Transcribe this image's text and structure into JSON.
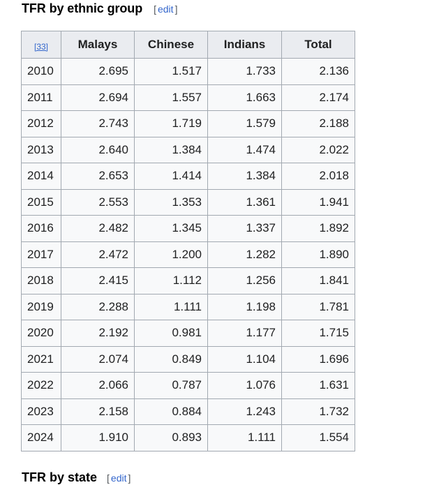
{
  "heading": {
    "title": "TFR by ethnic group",
    "edit_open": "[",
    "edit_label": "edit",
    "edit_close": "]"
  },
  "table": {
    "ref_label": "[33]",
    "columns": [
      "Malays",
      "Chinese",
      "Indians",
      "Total"
    ],
    "rows": [
      [
        "2010",
        "2.695",
        "1.517",
        "1.733",
        "2.136"
      ],
      [
        "2011",
        "2.694",
        "1.557",
        "1.663",
        "2.174"
      ],
      [
        "2012",
        "2.743",
        "1.719",
        "1.579",
        "2.188"
      ],
      [
        "2013",
        "2.640",
        "1.384",
        "1.474",
        "2.022"
      ],
      [
        "2014",
        "2.653",
        "1.414",
        "1.384",
        "2.018"
      ],
      [
        "2015",
        "2.553",
        "1.353",
        "1.361",
        "1.941"
      ],
      [
        "2016",
        "2.482",
        "1.345",
        "1.337",
        "1.892"
      ],
      [
        "2017",
        "2.472",
        "1.200",
        "1.282",
        "1.890"
      ],
      [
        "2018",
        "2.415",
        "1.112",
        "1.256",
        "1.841"
      ],
      [
        "2019",
        "2.288",
        "1.111",
        "1.198",
        "1.781"
      ],
      [
        "2020",
        "2.192",
        "0.981",
        "1.177",
        "1.715"
      ],
      [
        "2021",
        "2.074",
        "0.849",
        "1.104",
        "1.696"
      ],
      [
        "2022",
        "2.066",
        "0.787",
        "1.076",
        "1.631"
      ],
      [
        "2023",
        "2.158",
        "0.884",
        "1.243",
        "1.732"
      ],
      [
        "2024",
        "1.910",
        "0.893",
        "1.111",
        "1.554"
      ]
    ]
  },
  "next_heading": {
    "title": "TFR by state",
    "edit_open": "[",
    "edit_label": "edit",
    "edit_close": "]"
  }
}
